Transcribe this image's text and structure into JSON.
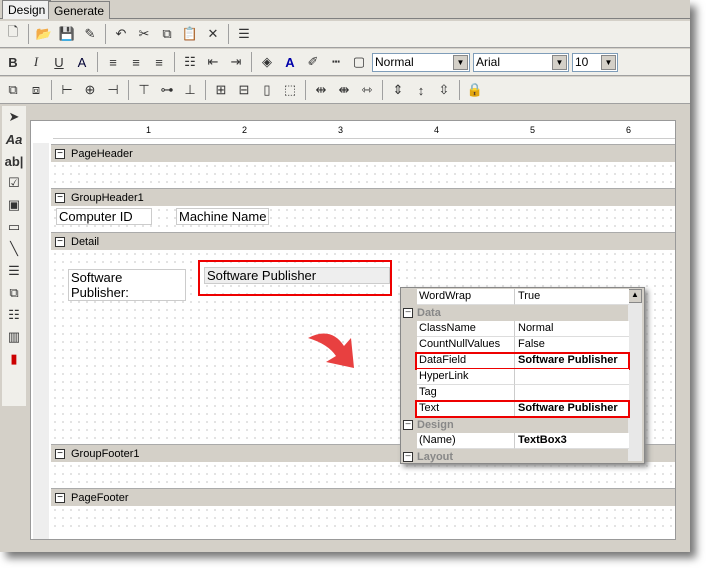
{
  "tabs": [
    {
      "label": "Design"
    },
    {
      "label": "Generate"
    }
  ],
  "toolbar": {
    "style": "Normal",
    "font": "Arial",
    "size": "10"
  },
  "sections": [
    {
      "label": "PageHeader"
    },
    {
      "label": "GroupHeader1"
    },
    {
      "label": "Detail"
    },
    {
      "label": "GroupFooter1"
    },
    {
      "label": "PageFooter"
    }
  ],
  "ruler": [
    "1",
    "2",
    "3",
    "4",
    "5",
    "6"
  ],
  "fields": {
    "computer_id": "Computer ID",
    "machine_name": "Machine Name",
    "publisher_label": "Software Publisher:",
    "publisher_box": "Software Publisher"
  },
  "properties": {
    "rows": [
      {
        "k": "WordWrap",
        "v": "True"
      },
      {
        "cat": "Data"
      },
      {
        "k": "ClassName",
        "v": "Normal"
      },
      {
        "k": "CountNullValues",
        "v": "False"
      },
      {
        "k": "DataField",
        "v": "Software Publisher",
        "bold": true
      },
      {
        "k": "HyperLink",
        "v": ""
      },
      {
        "k": "Tag",
        "v": ""
      },
      {
        "k": "Text",
        "v": "Software Publisher",
        "bold": true
      },
      {
        "cat": "Design"
      },
      {
        "k": "(Name)",
        "v": "TextBox3",
        "bold": true
      },
      {
        "cat": "Layout"
      }
    ]
  },
  "colors": {
    "highlight": "#e00000"
  }
}
